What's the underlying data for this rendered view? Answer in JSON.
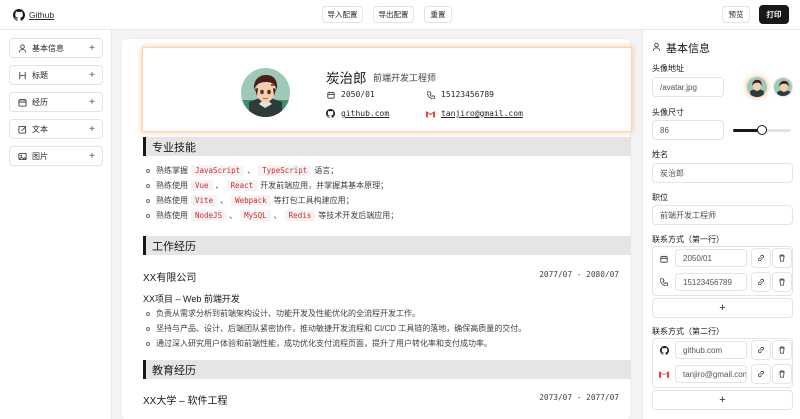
{
  "topbar": {
    "github_label": "Github",
    "import_label": "导入配置",
    "export_label": "导出配置",
    "reset_label": "重置",
    "preview_label": "预览",
    "print_label": "打印"
  },
  "sidebar": {
    "items": [
      {
        "label": "基本信息",
        "icon": "user-icon"
      },
      {
        "label": "标题",
        "icon": "heading-icon"
      },
      {
        "label": "经历",
        "icon": "calendar-icon"
      },
      {
        "label": "文本",
        "icon": "text-edit-icon"
      },
      {
        "label": "图片",
        "icon": "image-icon"
      }
    ]
  },
  "resume": {
    "name": "炭治郎",
    "job": "前端开发工程师",
    "birth": "2050/01",
    "phone": "15123456789",
    "github": "github.com",
    "email": "tanjiro@gmail.com",
    "skills_title": "专业技能",
    "skills": [
      {
        "pre": "熟练掌握",
        "tags": [
          "JavaScript",
          "TypeScript"
        ],
        "post": "语言；"
      },
      {
        "pre": "熟练使用",
        "tags": [
          "Vue",
          "React"
        ],
        "post": "开发前端应用，并掌握其基本原理；"
      },
      {
        "pre": "熟练使用",
        "tags": [
          "Vite",
          "Webpack"
        ],
        "post": "等打包工具构建应用；"
      },
      {
        "pre": "熟练使用",
        "tags": [
          "NodeJS",
          "MySQL",
          "Redis"
        ],
        "post": "等技术开发后端应用；"
      }
    ],
    "work_title": "工作经历",
    "company": "XX有限公司",
    "company_dates": "2077/07 - 2080/07",
    "project": "XX项目 – Web 前端开发",
    "work_items": [
      "负责从需求分析到前端架构设计、功能开发及性能优化的全流程开发工作。",
      "坚持与产品、设计、后端团队紧密协作，推动敏捷开发流程和 CI/CD 工具链的落地，确保高质量的交付。",
      "通过深入研究用户体验和前端性能，成功优化支付流程页面，提升了用户转化率和支付成功率。"
    ],
    "edu_title": "教育经历",
    "school": "XX大学 – 软件工程",
    "school_dates": "2073/07 - 2077/07"
  },
  "panel": {
    "title": "基本信息",
    "avatar_label": "头像地址",
    "avatar_value": "/avatar.jpg",
    "size_label": "头像尺寸",
    "size_value": "86",
    "size_slider": 0.5,
    "name_label": "姓名",
    "name_value": "炭治郎",
    "job_label": "职位",
    "job_value": "前端开发工程师",
    "contact1_label": "联系方式（第一行）",
    "contact1": [
      "2050/01",
      "15123456789"
    ],
    "contact2_label": "联系方式（第二行）",
    "contact2": [
      "github.com",
      "tanjiro@gmail.com"
    ],
    "add_symbol": "+"
  },
  "colors": {
    "accent_glow": "#f9923c",
    "dark": "#18181b",
    "code_red": "#dc2626"
  }
}
